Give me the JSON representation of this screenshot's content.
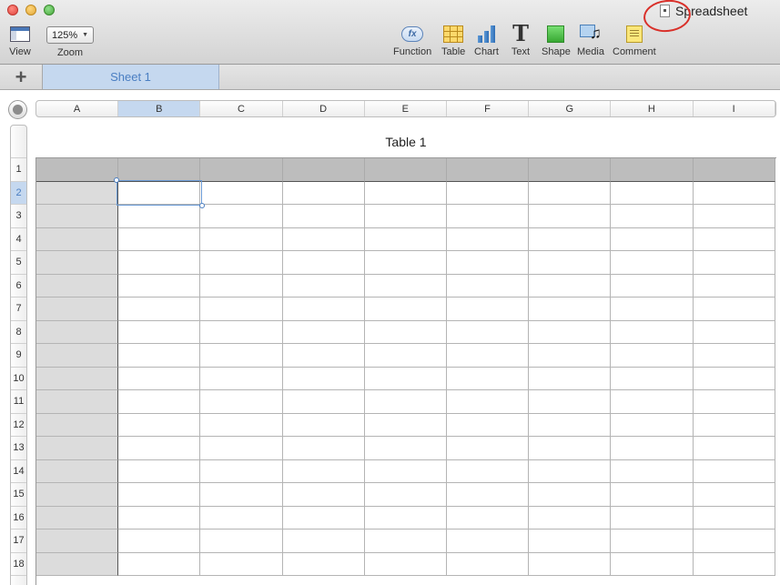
{
  "window": {
    "document_title": "Spreadsheet",
    "annotation_color": "#d9302a"
  },
  "toolbar": {
    "view_label": "View",
    "zoom_label": "Zoom",
    "zoom_value": "125%",
    "function_label": "Function",
    "function_icon_text": "fx",
    "table_label": "Table",
    "chart_label": "Chart",
    "text_label": "Text",
    "text_icon_text": "T",
    "shape_label": "Shape",
    "media_label": "Media",
    "comment_label": "Comment"
  },
  "sheets": {
    "add_symbol": "+",
    "tabs": [
      {
        "label": "Sheet 1",
        "selected": true
      }
    ]
  },
  "table": {
    "title": "Table 1",
    "columns": [
      "A",
      "B",
      "C",
      "D",
      "E",
      "F",
      "G",
      "H",
      "I"
    ],
    "selected_column": "B",
    "rows": [
      "1",
      "2",
      "3",
      "4",
      "5",
      "6",
      "7",
      "8",
      "9",
      "10",
      "11",
      "12",
      "13",
      "14",
      "15",
      "16",
      "17",
      "18"
    ],
    "selected_row": "2",
    "selected_cell": "B2",
    "accent_color": "#c5d8ef"
  }
}
